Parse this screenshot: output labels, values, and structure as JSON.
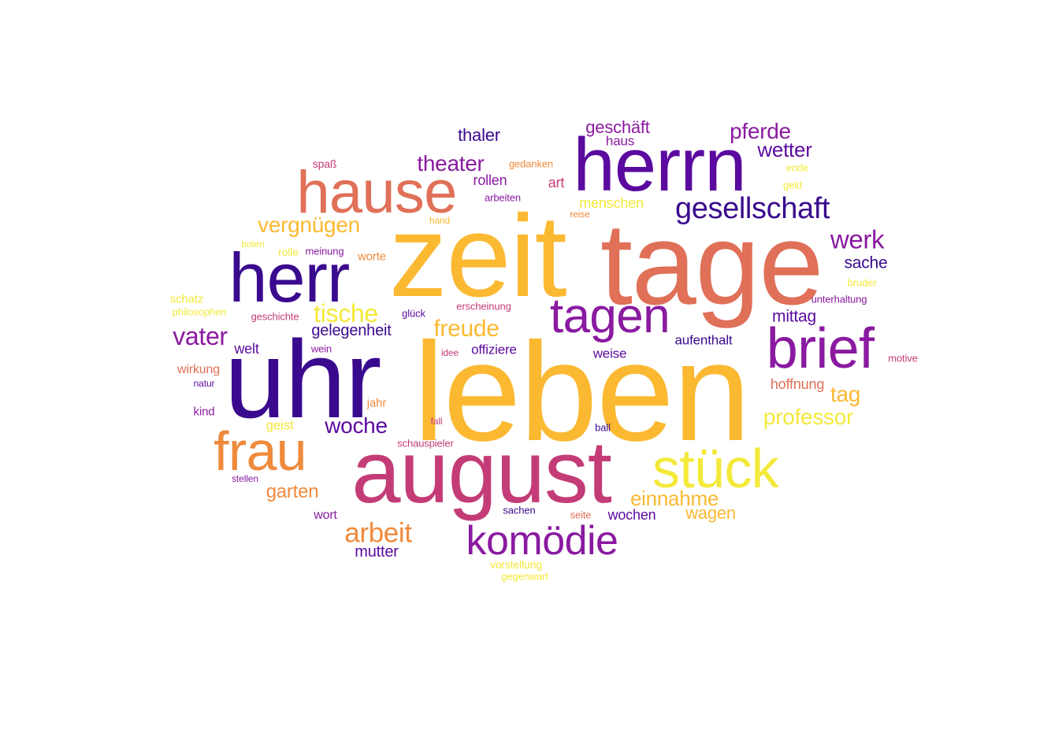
{
  "palette": {
    "p1": "#3a0a8e",
    "p2": "#5b0a9f",
    "p3": "#8a1aa0",
    "p4": "#c43c77",
    "p5": "#e07058",
    "p6": "#ef8a3c",
    "p7": "#fbb932",
    "p8": "#f3e93a"
  },
  "words": [
    {
      "text": "leben",
      "color": "p7"
    },
    {
      "text": "zeit",
      "color": "p7"
    },
    {
      "text": "tage",
      "color": "p5"
    },
    {
      "text": "uhr",
      "color": "p1"
    },
    {
      "text": "august",
      "color": "p4"
    },
    {
      "text": "herrn",
      "color": "p2"
    },
    {
      "text": "herr",
      "color": "p1"
    },
    {
      "text": "hause",
      "color": "p5"
    },
    {
      "text": "brief",
      "color": "p3"
    },
    {
      "text": "tagen",
      "color": "p3"
    },
    {
      "text": "frau",
      "color": "p6"
    },
    {
      "text": "stück",
      "color": "p8"
    },
    {
      "text": "komödie",
      "color": "p3"
    },
    {
      "text": "gesellschaft",
      "color": "p1"
    },
    {
      "text": "arbeit",
      "color": "p6"
    },
    {
      "text": "werk",
      "color": "p3"
    },
    {
      "text": "vater",
      "color": "p3"
    },
    {
      "text": "theater",
      "color": "p3"
    },
    {
      "text": "pferde",
      "color": "p3"
    },
    {
      "text": "vergnügen",
      "color": "p7"
    },
    {
      "text": "tische",
      "color": "p8"
    },
    {
      "text": "freude",
      "color": "p7"
    },
    {
      "text": "professor",
      "color": "p8"
    },
    {
      "text": "woche",
      "color": "p2"
    },
    {
      "text": "einnahme",
      "color": "p7"
    },
    {
      "text": "tag",
      "color": "p7"
    },
    {
      "text": "thaler",
      "color": "p1"
    },
    {
      "text": "geschäft",
      "color": "p3"
    },
    {
      "text": "wetter",
      "color": "p2"
    },
    {
      "text": "sache",
      "color": "p1"
    },
    {
      "text": "mittag",
      "color": "p2"
    },
    {
      "text": "garten",
      "color": "p6"
    },
    {
      "text": "wagen",
      "color": "p7"
    },
    {
      "text": "wochen",
      "color": "p2"
    },
    {
      "text": "mutter",
      "color": "p2"
    },
    {
      "text": "gelegenheit",
      "color": "p1"
    },
    {
      "text": "hoffnung",
      "color": "p5"
    },
    {
      "text": "menschen",
      "color": "p8"
    },
    {
      "text": "rollen",
      "color": "p3"
    },
    {
      "text": "aufenthalt",
      "color": "p1"
    },
    {
      "text": "offiziere",
      "color": "p2"
    },
    {
      "text": "weise",
      "color": "p2"
    },
    {
      "text": "welt",
      "color": "p2"
    },
    {
      "text": "haus",
      "color": "p3"
    },
    {
      "text": "art",
      "color": "p4"
    },
    {
      "text": "wirkung",
      "color": "p5"
    },
    {
      "text": "wort",
      "color": "p3"
    },
    {
      "text": "kind",
      "color": "p3"
    },
    {
      "text": "geist",
      "color": "p8"
    },
    {
      "text": "worte",
      "color": "p6"
    },
    {
      "text": "schatz",
      "color": "p8"
    },
    {
      "text": "jahr",
      "color": "p6"
    },
    {
      "text": "vorstellung",
      "color": "p8"
    },
    {
      "text": "gedanken",
      "color": "p6"
    },
    {
      "text": "ende",
      "color": "p8"
    },
    {
      "text": "geld",
      "color": "p8"
    },
    {
      "text": "arbeiten",
      "color": "p3"
    },
    {
      "text": "spaß",
      "color": "p4"
    },
    {
      "text": "reise",
      "color": "p6"
    },
    {
      "text": "hand",
      "color": "p7"
    },
    {
      "text": "boten",
      "color": "p8"
    },
    {
      "text": "rolle",
      "color": "p8"
    },
    {
      "text": "meinung",
      "color": "p3"
    },
    {
      "text": "philosophen",
      "color": "p8"
    },
    {
      "text": "geschichte",
      "color": "p4"
    },
    {
      "text": "glück",
      "color": "p2"
    },
    {
      "text": "erscheinung",
      "color": "p4"
    },
    {
      "text": "bruder",
      "color": "p8"
    },
    {
      "text": "unterhaltung",
      "color": "p3"
    },
    {
      "text": "motive",
      "color": "p4"
    },
    {
      "text": "wein",
      "color": "p3"
    },
    {
      "text": "idee",
      "color": "p4"
    },
    {
      "text": "natur",
      "color": "p2"
    },
    {
      "text": "fall",
      "color": "p4"
    },
    {
      "text": "schauspieler",
      "color": "p4"
    },
    {
      "text": "ball",
      "color": "p1"
    },
    {
      "text": "stellen",
      "color": "p3"
    },
    {
      "text": "sachen",
      "color": "p1"
    },
    {
      "text": "seite",
      "color": "p5"
    },
    {
      "text": "gegenwart",
      "color": "p8"
    }
  ]
}
